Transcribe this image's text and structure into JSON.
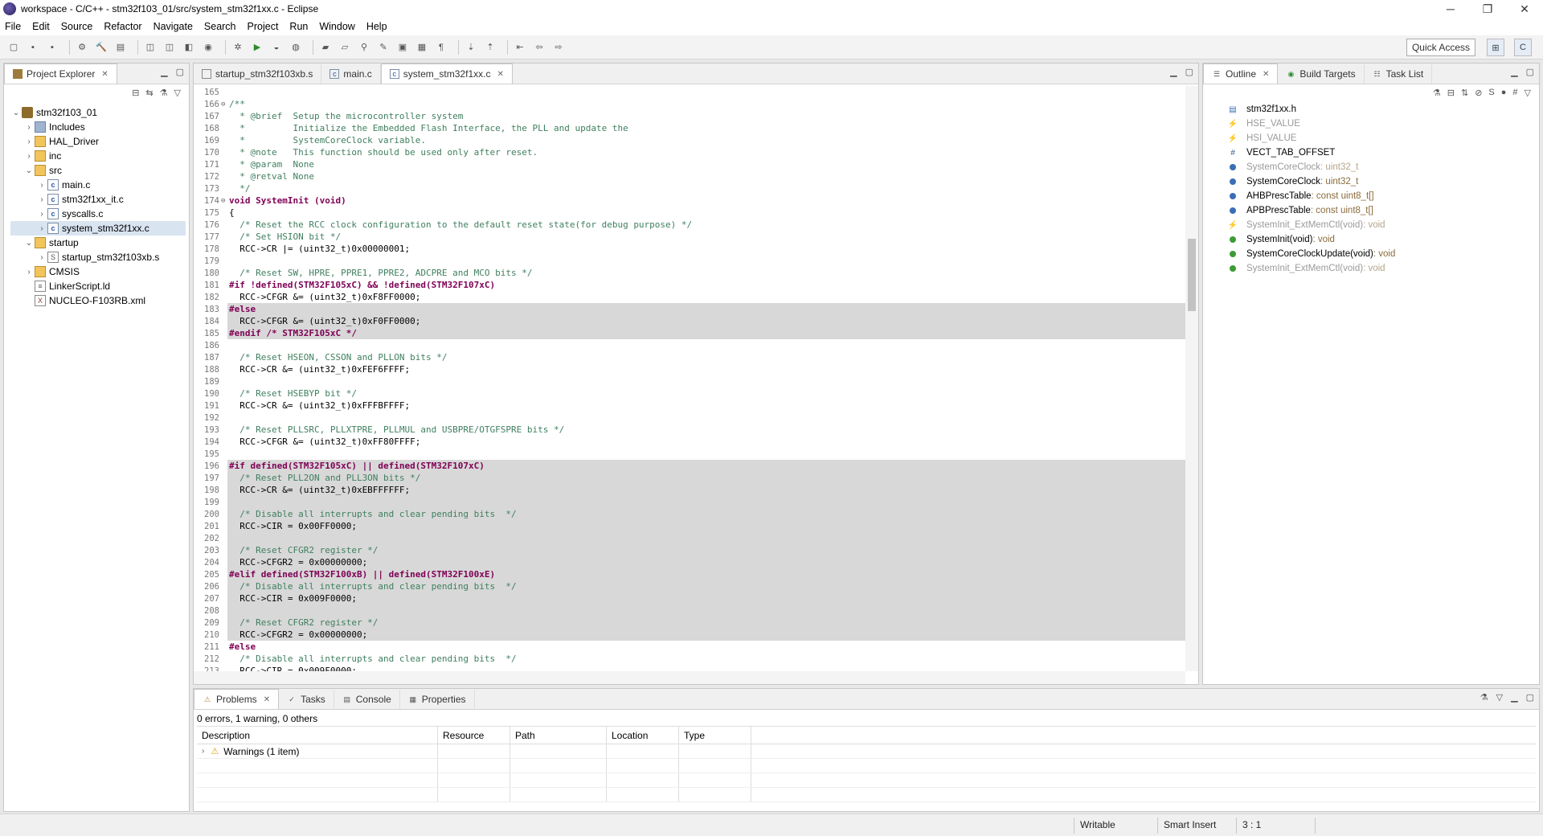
{
  "window": {
    "title": "workspace - C/C++ - stm32f103_01/src/system_stm32f1xx.c - Eclipse",
    "controls": [
      "─",
      "❐",
      "✕"
    ]
  },
  "menu": [
    "File",
    "Edit",
    "Source",
    "Refactor",
    "Navigate",
    "Search",
    "Project",
    "Run",
    "Window",
    "Help"
  ],
  "toolbar": {
    "quick_access": "Quick Access"
  },
  "project_explorer": {
    "tab_label": "Project Explorer",
    "items": [
      {
        "label": "stm32f103_01",
        "depth": 0,
        "twisty": "v",
        "icon": "project-icon"
      },
      {
        "label": "Includes",
        "depth": 1,
        "twisty": ">",
        "icon": "includes-icon"
      },
      {
        "label": "HAL_Driver",
        "depth": 1,
        "twisty": ">",
        "icon": "folder-icon"
      },
      {
        "label": "inc",
        "depth": 1,
        "twisty": ">",
        "icon": "folder-icon"
      },
      {
        "label": "src",
        "depth": 1,
        "twisty": "v",
        "icon": "folder-icon"
      },
      {
        "label": "main.c",
        "depth": 2,
        "twisty": ">",
        "icon": "c-file-icon"
      },
      {
        "label": "stm32f1xx_it.c",
        "depth": 2,
        "twisty": ">",
        "icon": "c-file-icon"
      },
      {
        "label": "syscalls.c",
        "depth": 2,
        "twisty": ">",
        "icon": "c-file-icon"
      },
      {
        "label": "system_stm32f1xx.c",
        "depth": 2,
        "twisty": ">",
        "icon": "c-file-icon",
        "selected": true
      },
      {
        "label": "startup",
        "depth": 1,
        "twisty": "v",
        "icon": "folder-icon"
      },
      {
        "label": "startup_stm32f103xb.s",
        "depth": 2,
        "twisty": ">",
        "icon": "asm-file-icon"
      },
      {
        "label": "CMSIS",
        "depth": 1,
        "twisty": ">",
        "icon": "folder-icon"
      },
      {
        "label": "LinkerScript.ld",
        "depth": 1,
        "twisty": "",
        "icon": "file-icon"
      },
      {
        "label": "NUCLEO-F103RB.xml",
        "depth": 1,
        "twisty": "",
        "icon": "xml-file-icon"
      }
    ]
  },
  "editor": {
    "tabs": [
      {
        "label": "startup_stm32f103xb.s",
        "active": false
      },
      {
        "label": "main.c",
        "active": false
      },
      {
        "label": "system_stm32f1xx.c",
        "active": true
      }
    ],
    "lines": [
      {
        "n": "165",
        "fold": "",
        "text": "",
        "inactive": false,
        "style": "nm"
      },
      {
        "n": "166",
        "fold": "⊖",
        "text": "/**",
        "inactive": false,
        "style": "cm"
      },
      {
        "n": "167",
        "fold": "",
        "text": "  * @brief  Setup the microcontroller system",
        "inactive": false,
        "style": "cm"
      },
      {
        "n": "168",
        "fold": "",
        "text": "  *         Initialize the Embedded Flash Interface, the PLL and update the",
        "inactive": false,
        "style": "cm"
      },
      {
        "n": "169",
        "fold": "",
        "text": "  *         SystemCoreClock variable.",
        "inactive": false,
        "style": "cm"
      },
      {
        "n": "170",
        "fold": "",
        "text": "  * @note   This function should be used only after reset.",
        "inactive": false,
        "style": "cm"
      },
      {
        "n": "171",
        "fold": "",
        "text": "  * @param  None",
        "inactive": false,
        "style": "cm"
      },
      {
        "n": "172",
        "fold": "",
        "text": "  * @retval None",
        "inactive": false,
        "style": "cm"
      },
      {
        "n": "173",
        "fold": "",
        "text": "  */",
        "inactive": false,
        "style": "cm"
      },
      {
        "n": "174",
        "fold": "⊖",
        "text": "void SystemInit (void)",
        "inactive": false,
        "style": "kw"
      },
      {
        "n": "175",
        "fold": "",
        "text": "{",
        "inactive": false,
        "style": "nm"
      },
      {
        "n": "176",
        "fold": "",
        "text": "  /* Reset the RCC clock configuration to the default reset state(for debug purpose) */",
        "inactive": false,
        "style": "cm"
      },
      {
        "n": "177",
        "fold": "",
        "text": "  /* Set HSION bit */",
        "inactive": false,
        "style": "cm"
      },
      {
        "n": "178",
        "fold": "",
        "text": "  RCC->CR |= (uint32_t)0x00000001;",
        "inactive": false,
        "style": "nm"
      },
      {
        "n": "179",
        "fold": "",
        "text": "",
        "inactive": false,
        "style": "nm"
      },
      {
        "n": "180",
        "fold": "",
        "text": "  /* Reset SW, HPRE, PPRE1, PPRE2, ADCPRE and MCO bits */",
        "inactive": false,
        "style": "cm"
      },
      {
        "n": "181",
        "fold": "",
        "text": "#if !defined(STM32F105xC) && !defined(STM32F107xC)",
        "inactive": false,
        "style": "pp"
      },
      {
        "n": "182",
        "fold": "",
        "text": "  RCC->CFGR &= (uint32_t)0xF8FF0000;",
        "inactive": false,
        "style": "nm"
      },
      {
        "n": "183",
        "fold": "",
        "text": "#else",
        "inactive": true,
        "style": "pp"
      },
      {
        "n": "184",
        "fold": "",
        "text": "  RCC->CFGR &= (uint32_t)0xF0FF0000;",
        "inactive": true,
        "style": "nm"
      },
      {
        "n": "185",
        "fold": "",
        "text": "#endif /* STM32F105xC */",
        "inactive": true,
        "style": "pp"
      },
      {
        "n": "186",
        "fold": "",
        "text": "",
        "inactive": false,
        "style": "nm"
      },
      {
        "n": "187",
        "fold": "",
        "text": "  /* Reset HSEON, CSSON and PLLON bits */",
        "inactive": false,
        "style": "cm"
      },
      {
        "n": "188",
        "fold": "",
        "text": "  RCC->CR &= (uint32_t)0xFEF6FFFF;",
        "inactive": false,
        "style": "nm"
      },
      {
        "n": "189",
        "fold": "",
        "text": "",
        "inactive": false,
        "style": "nm"
      },
      {
        "n": "190",
        "fold": "",
        "text": "  /* Reset HSEBYP bit */",
        "inactive": false,
        "style": "cm"
      },
      {
        "n": "191",
        "fold": "",
        "text": "  RCC->CR &= (uint32_t)0xFFFBFFFF;",
        "inactive": false,
        "style": "nm"
      },
      {
        "n": "192",
        "fold": "",
        "text": "",
        "inactive": false,
        "style": "nm"
      },
      {
        "n": "193",
        "fold": "",
        "text": "  /* Reset PLLSRC, PLLXTPRE, PLLMUL and USBPRE/OTGFSPRE bits */",
        "inactive": false,
        "style": "cm"
      },
      {
        "n": "194",
        "fold": "",
        "text": "  RCC->CFGR &= (uint32_t)0xFF80FFFF;",
        "inactive": false,
        "style": "nm"
      },
      {
        "n": "195",
        "fold": "",
        "text": "",
        "inactive": false,
        "style": "nm"
      },
      {
        "n": "196",
        "fold": "",
        "text": "#if defined(STM32F105xC) || defined(STM32F107xC)",
        "inactive": true,
        "style": "pp"
      },
      {
        "n": "197",
        "fold": "",
        "text": "  /* Reset PLL2ON and PLL3ON bits */",
        "inactive": true,
        "style": "cm"
      },
      {
        "n": "198",
        "fold": "",
        "text": "  RCC->CR &= (uint32_t)0xEBFFFFFF;",
        "inactive": true,
        "style": "nm"
      },
      {
        "n": "199",
        "fold": "",
        "text": "",
        "inactive": true,
        "style": "nm"
      },
      {
        "n": "200",
        "fold": "",
        "text": "  /* Disable all interrupts and clear pending bits  */",
        "inactive": true,
        "style": "cm"
      },
      {
        "n": "201",
        "fold": "",
        "text": "  RCC->CIR = 0x00FF0000;",
        "inactive": true,
        "style": "nm"
      },
      {
        "n": "202",
        "fold": "",
        "text": "",
        "inactive": true,
        "style": "nm"
      },
      {
        "n": "203",
        "fold": "",
        "text": "  /* Reset CFGR2 register */",
        "inactive": true,
        "style": "cm"
      },
      {
        "n": "204",
        "fold": "",
        "text": "  RCC->CFGR2 = 0x00000000;",
        "inactive": true,
        "style": "nm"
      },
      {
        "n": "205",
        "fold": "",
        "text": "#elif defined(STM32F100xB) || defined(STM32F100xE)",
        "inactive": true,
        "style": "pp"
      },
      {
        "n": "206",
        "fold": "",
        "text": "  /* Disable all interrupts and clear pending bits  */",
        "inactive": true,
        "style": "cm"
      },
      {
        "n": "207",
        "fold": "",
        "text": "  RCC->CIR = 0x009F0000;",
        "inactive": true,
        "style": "nm"
      },
      {
        "n": "208",
        "fold": "",
        "text": "",
        "inactive": true,
        "style": "nm"
      },
      {
        "n": "209",
        "fold": "",
        "text": "  /* Reset CFGR2 register */",
        "inactive": true,
        "style": "cm"
      },
      {
        "n": "210",
        "fold": "",
        "text": "  RCC->CFGR2 = 0x00000000;",
        "inactive": true,
        "style": "nm"
      },
      {
        "n": "211",
        "fold": "",
        "text": "#else",
        "inactive": false,
        "style": "pp"
      },
      {
        "n": "212",
        "fold": "",
        "text": "  /* Disable all interrupts and clear pending bits  */",
        "inactive": false,
        "style": "cm"
      },
      {
        "n": "213",
        "fold": "",
        "text": "  RCC->CIR = 0x009F0000;",
        "inactive": false,
        "style": "nm"
      }
    ]
  },
  "outline": {
    "tabs": [
      "Outline",
      "Build Targets",
      "Task List"
    ],
    "items": [
      {
        "name": "stm32f1xx.h",
        "type": "",
        "icon": "include-icon",
        "dim": false
      },
      {
        "name": "HSE_VALUE",
        "type": "",
        "icon": "macro-icon",
        "dim": true
      },
      {
        "name": "HSI_VALUE",
        "type": "",
        "icon": "macro-icon",
        "dim": true
      },
      {
        "name": "VECT_TAB_OFFSET",
        "type": "",
        "icon": "define-icon",
        "dim": false
      },
      {
        "name": "SystemCoreClock",
        "type": " : uint32_t",
        "icon": "variable-icon",
        "dim": true
      },
      {
        "name": "SystemCoreClock",
        "type": " : uint32_t",
        "icon": "variable-icon",
        "dim": false
      },
      {
        "name": "AHBPrescTable",
        "type": " : const uint8_t[]",
        "icon": "const-variable-icon",
        "dim": false
      },
      {
        "name": "APBPrescTable",
        "type": " : const uint8_t[]",
        "icon": "const-variable-icon",
        "dim": false
      },
      {
        "name": "SystemInit_ExtMemCtl(void)",
        "type": " : void",
        "icon": "static-function-icon",
        "dim": true
      },
      {
        "name": "SystemInit(void)",
        "type": " : void",
        "icon": "function-icon",
        "dim": false
      },
      {
        "name": "SystemCoreClockUpdate(void)",
        "type": " : void",
        "icon": "function-icon",
        "dim": false
      },
      {
        "name": "SystemInit_ExtMemCtl(void)",
        "type": " : void",
        "icon": "function-icon",
        "dim": true
      }
    ]
  },
  "problems": {
    "tabs": [
      "Problems",
      "Tasks",
      "Console",
      "Properties"
    ],
    "summary": "0 errors, 1 warning, 0 others",
    "columns": [
      "Description",
      "Resource",
      "Path",
      "Location",
      "Type"
    ],
    "rows": [
      {
        "description": "Warnings (1 item)",
        "resource": "",
        "path": "",
        "location": "",
        "type": ""
      }
    ]
  },
  "status": {
    "writable": "Writable",
    "insert_mode": "Smart Insert",
    "position": "3 : 1"
  }
}
